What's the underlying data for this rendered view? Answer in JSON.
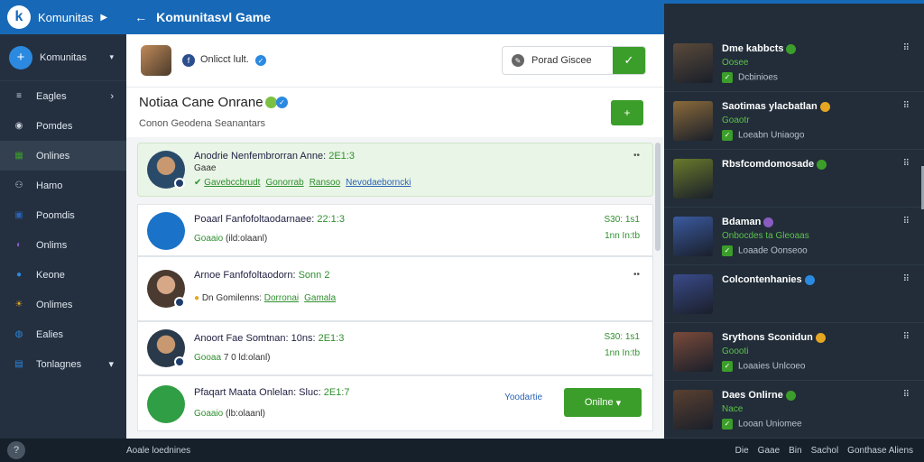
{
  "topbar": {
    "brand": "Komunitas",
    "title": "Komunitasvl Game",
    "icons": [
      "back-icon",
      "refresh-icon",
      "search-icon"
    ]
  },
  "sidebar": {
    "header": "Komunitas",
    "items": [
      {
        "label": "Eagles",
        "icon": "menu-icon",
        "color": "#cfd6dd",
        "chevron": true
      },
      {
        "label": "Pomdes",
        "icon": "disc-icon",
        "color": "#cfd6dd"
      },
      {
        "label": "Onlines",
        "icon": "grid-icon",
        "color": "#3c9e2a",
        "active": true
      },
      {
        "label": "Hamo",
        "icon": "user-icon",
        "color": "#cfd6dd"
      },
      {
        "label": "Poomdis",
        "icon": "image-icon",
        "color": "#2b63b5"
      },
      {
        "label": "Onlims",
        "icon": "circle-icon",
        "color": "#8a5cc2"
      },
      {
        "label": "Keone",
        "icon": "ball-icon",
        "color": "#2b8ae0"
      },
      {
        "label": "Onlimes",
        "icon": "sun-icon",
        "color": "#e6a623"
      },
      {
        "label": "Ealies",
        "icon": "globe-icon",
        "color": "#2b8ae0"
      },
      {
        "label": "Tonlagnes",
        "icon": "box-icon",
        "color": "#2b8ae0",
        "chevron": true
      }
    ]
  },
  "main": {
    "user": "Onlicct lult.",
    "search_placeholder": "Porad Giscee",
    "title": "Notiaa Cane Onrane",
    "subtitle": "Conon Geodena Seanantars",
    "feed": [
      {
        "name": "Anodrie Nenfembrorran Anne:",
        "time": "2E1:3",
        "meta": "Gaae",
        "tags": [
          "Gavebccbrudt",
          "Gonorrab",
          "Ransoo"
        ],
        "tag_blue": "Nevodaeborncki"
      },
      {
        "name": "Poaarl Fanfofoltaodarnaee:",
        "time": "22:1:3",
        "meta_g": "Goaaio",
        "meta": "(ild:olaanl)",
        "right1": "S30: 1s1",
        "right2": "1nn In:tb"
      },
      {
        "name": "Arnoe Fanfofoltaodorn:",
        "time": "Sonn 2",
        "meta": "Dn Gomilenns:",
        "tags": [
          "Dorronai",
          "Gamala"
        ]
      },
      {
        "name": "Anoort Fae Somtnan: 10ns:",
        "time": "2E1:3",
        "meta_g": "Gooaa",
        "meta": "7 0 ld:olanl)",
        "right1": "S30: 1s1",
        "right2": "1nn In:tb"
      },
      {
        "name": "Pfaqart Maata Onlelan: Sluc:",
        "time": "2E1:7",
        "meta_g": "Goaaio",
        "meta": "(lb:olaanl)",
        "link": "Yoodartie",
        "button": "Onilne"
      }
    ]
  },
  "right": {
    "items": [
      {
        "name": "Dme kabbcts",
        "sub": "Oosee",
        "sub2": "Dcbinioes",
        "thumb": "#5a4a3a"
      },
      {
        "name": "Saotimas ylacbatlan",
        "sub": "Goaotr",
        "sub2": "Loeabn Uniaogo",
        "thumb": "#8a6a3a"
      },
      {
        "name": "Rbsfcomdomosade",
        "sub": "",
        "sub2": "",
        "thumb": "#6a7a2a"
      },
      {
        "name": "Bdaman",
        "sub": "Onbocdes ta Gleoaas",
        "sub2": "Loaade Oonseoo",
        "thumb": "#3a5aa0"
      },
      {
        "name": "Colcontenhanies",
        "sub": "",
        "sub2": "",
        "thumb": "#3a4a8a"
      },
      {
        "name": "Srythons Sconidun",
        "sub": "Goooti",
        "sub2": "Loaaies Unlcoeo",
        "thumb": "#7a4a3a"
      },
      {
        "name": "Daes Onlirne",
        "sub": "Nace",
        "sub2": "Looan Uniomee",
        "thumb": "#5a4030"
      }
    ]
  },
  "bottombar": {
    "status": "Aoale loednines",
    "links": [
      "Die",
      "Gaae",
      "Bin",
      "Sachol",
      "Gonthase Aliens"
    ]
  }
}
